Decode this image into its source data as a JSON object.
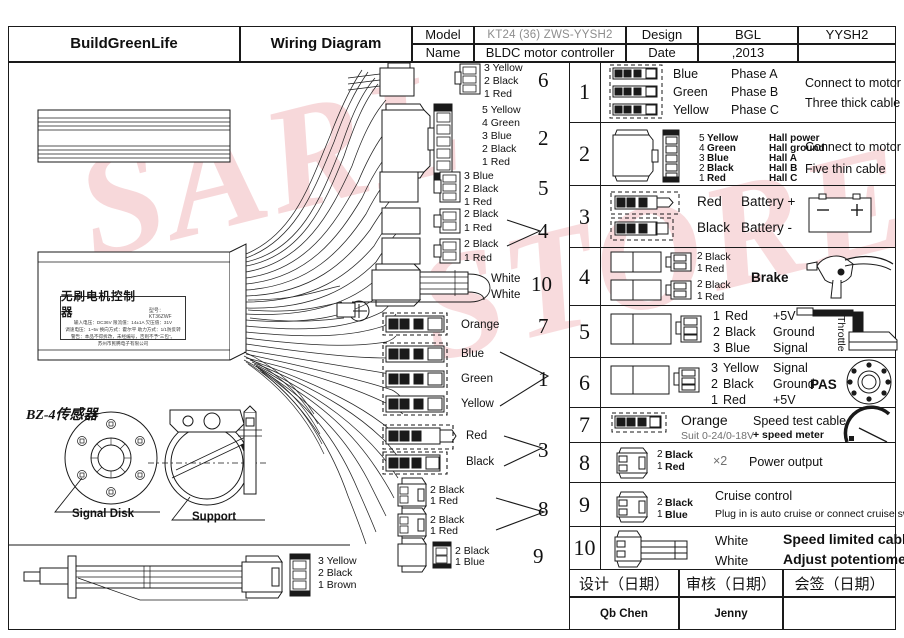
{
  "titleblock": {
    "company": "BuildGreenLife",
    "doc_type": "Wiring Diagram",
    "model_label": "Model",
    "model_value": "KT24 (36) ZWS-YYSH2",
    "name_label": "Name",
    "name_value": "BLDC motor controller",
    "design_label": "Design",
    "design_value": "BGL",
    "date_label": "Date",
    "date_value": ",2013",
    "code": "YYSH2"
  },
  "controller_label": {
    "title": "无刷电机控制器",
    "model_prefix": "型号：KT36ZWF",
    "spec_line1": "输入电压：DC36V   限流值：14±1A     欠压值：31V",
    "spec_line2": "调速电压：1~5v    换向方式：霍尔平    助力方式：1/1防反转",
    "spec_line3": "警告：本品不得拆改，未经编号，否则不予“三包”。",
    "maker": "苏州市民腾电子有限公司"
  },
  "diagram": {
    "callouts": [
      {
        "number": "6",
        "lines": [
          "3  Yellow",
          "2  Black",
          "1  Red"
        ]
      },
      {
        "number": "2",
        "lines": [
          "5  Yellow",
          "4  Green",
          "3  Blue",
          "2  Black",
          "1  Red"
        ]
      },
      {
        "number": "5",
        "lines": [
          "3  Blue",
          "2  Black",
          "1  Red"
        ]
      },
      {
        "number": "4",
        "lines": [
          "2  Black",
          "1  Red",
          "2  Black",
          "1  Red"
        ]
      },
      {
        "number": "10",
        "lines": [
          "White",
          "White"
        ]
      },
      {
        "number": "7",
        "lines": [
          "Orange"
        ]
      },
      {
        "number": "1",
        "lines": [
          "Blue",
          "Green",
          "Yellow"
        ]
      },
      {
        "number": "3",
        "lines": [
          "Red",
          "Black"
        ]
      },
      {
        "number": "8",
        "lines": [
          "2 Black",
          "1 Red",
          "2 Black",
          "1 Red"
        ]
      },
      {
        "number": "9",
        "lines": [
          "2 Black",
          "1 Blue"
        ]
      }
    ],
    "sensor": {
      "part_name": "BZ-4传感器",
      "signal_disk": "Signal  Disk",
      "support": "Support",
      "cable_pins": [
        "3 Yellow",
        "2 Black",
        "1 Brown"
      ]
    }
  },
  "spec_table": [
    {
      "num": "1",
      "wires": [
        {
          "color": "Blue",
          "func": "Phase A"
        },
        {
          "color": "Green",
          "func": "Phase  B"
        },
        {
          "color": "Yellow",
          "func": "Phase C"
        }
      ],
      "notes": [
        "Connect to motor",
        "Three thick cable"
      ]
    },
    {
      "num": "2",
      "pins": [
        {
          "n": "5",
          "color": "Yellow",
          "func": "Hall power"
        },
        {
          "n": "4",
          "color": "Green",
          "func": "Hall ground"
        },
        {
          "n": "3",
          "color": "Blue",
          "func": "Hall A"
        },
        {
          "n": "2",
          "color": "Black",
          "func": "Hall B"
        },
        {
          "n": "1",
          "color": "Red",
          "func": "Hall C"
        }
      ],
      "notes": [
        "Connect to  motor",
        "Five thin cable"
      ]
    },
    {
      "num": "3",
      "wires": [
        {
          "color": "Red",
          "func": "Battery +"
        },
        {
          "color": "Black",
          "func": "Battery -"
        }
      ],
      "notes": [],
      "graphic": "battery"
    },
    {
      "num": "4",
      "pins": [
        {
          "n": "2",
          "color": "Black",
          "func": ""
        },
        {
          "n": "1",
          "color": "Red",
          "func": ""
        },
        {
          "n": "2",
          "color": "Black",
          "func": ""
        },
        {
          "n": "1",
          "color": "Red",
          "func": ""
        }
      ],
      "notes": [
        "Brake"
      ],
      "graphic": "brake-lever"
    },
    {
      "num": "5",
      "pins": [
        {
          "n": "1",
          "color": "Red",
          "func": "+5V"
        },
        {
          "n": "2",
          "color": "Black",
          "func": "Ground"
        },
        {
          "n": "3",
          "color": "Blue",
          "func": "Signal"
        }
      ],
      "notes": [
        "Throttle"
      ],
      "graphic": "throttle"
    },
    {
      "num": "6",
      "pins": [
        {
          "n": "3",
          "color": "Yellow",
          "func": "Signal"
        },
        {
          "n": "2",
          "color": "Black",
          "func": "Ground"
        },
        {
          "n": "1",
          "color": "Red",
          "func": "+5V"
        }
      ],
      "notes": [
        "PAS"
      ],
      "graphic": "pas-disk"
    },
    {
      "num": "7",
      "wires": [
        {
          "color": "Orange",
          "func": "Speed test cable"
        }
      ],
      "notes": [
        "Suit 0-24/0-18V",
        "+ speed meter"
      ],
      "graphic": "speed-meter"
    },
    {
      "num": "8",
      "pins": [
        {
          "n": "2",
          "color": "Black",
          "func": ""
        },
        {
          "n": "1",
          "color": "Red",
          "func": ""
        }
      ],
      "notes": [
        "×2",
        "Power output"
      ]
    },
    {
      "num": "9",
      "pins": [
        {
          "n": "2",
          "color": "Black",
          "func": ""
        },
        {
          "n": "1",
          "color": "Blue",
          "func": ""
        }
      ],
      "notes": [
        "Cruise  control",
        "Plug in is auto cruise or connect cruise switch"
      ]
    },
    {
      "num": "10",
      "wires": [
        {
          "color": "White",
          "func": "Speed limited cable"
        },
        {
          "color": "White",
          "func": "Adjust potentiometer"
        }
      ],
      "notes": []
    }
  ],
  "signature_row": {
    "headers": [
      "设计（日期）",
      "审核（日期）",
      "会签（日期）"
    ],
    "values": [
      "Qb Chen",
      "Jenny",
      ""
    ]
  },
  "watermark": {
    "line1": "SARL",
    "line2": "STORE"
  },
  "colors": {
    "ink": "#1a1a1a",
    "watermark": "#f2b9bd"
  }
}
